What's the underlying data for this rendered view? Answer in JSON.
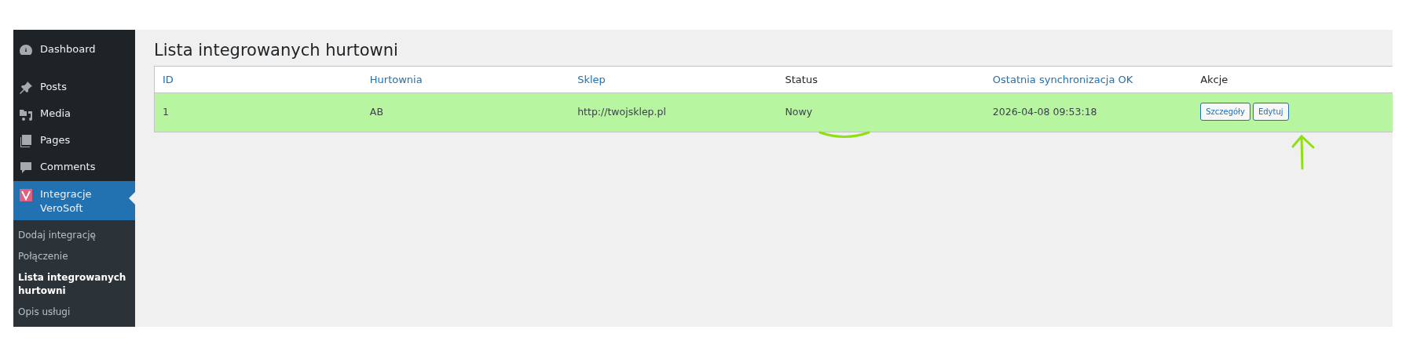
{
  "sidebar": {
    "menu": [
      {
        "label": "Dashboard",
        "selected": false
      },
      {
        "label": "Posts",
        "selected": false
      },
      {
        "label": "Media",
        "selected": false
      },
      {
        "label": "Pages",
        "selected": false
      },
      {
        "label": "Comments",
        "selected": false
      },
      {
        "label": "Integracje VeroSoft",
        "selected": true
      }
    ],
    "submenu": [
      {
        "label": "Dodaj integrację",
        "selected": false
      },
      {
        "label": "Połączenie",
        "selected": false
      },
      {
        "label": "Lista integrowanych hurtowni",
        "selected": true
      },
      {
        "label": "Opis usługi",
        "selected": false
      }
    ]
  },
  "page_title": "Lista integrowanych hurtowni",
  "table": {
    "columns": [
      {
        "label": "ID",
        "sortable": true
      },
      {
        "label": "Hurtownia",
        "sortable": true
      },
      {
        "label": "Sklep",
        "sortable": true
      },
      {
        "label": "Status",
        "sortable": false
      },
      {
        "label": "Ostatnia synchronizacja OK",
        "sortable": true
      },
      {
        "label": "Akcje",
        "sortable": false
      }
    ],
    "rows": [
      {
        "highlighted": true,
        "cells": [
          "1",
          "AB",
          "http://twojsklep.pl",
          "Nowy",
          "2026-04-08 09:53:18"
        ],
        "actions": [
          "Szczegóły",
          "Edytuj"
        ]
      }
    ]
  }
}
